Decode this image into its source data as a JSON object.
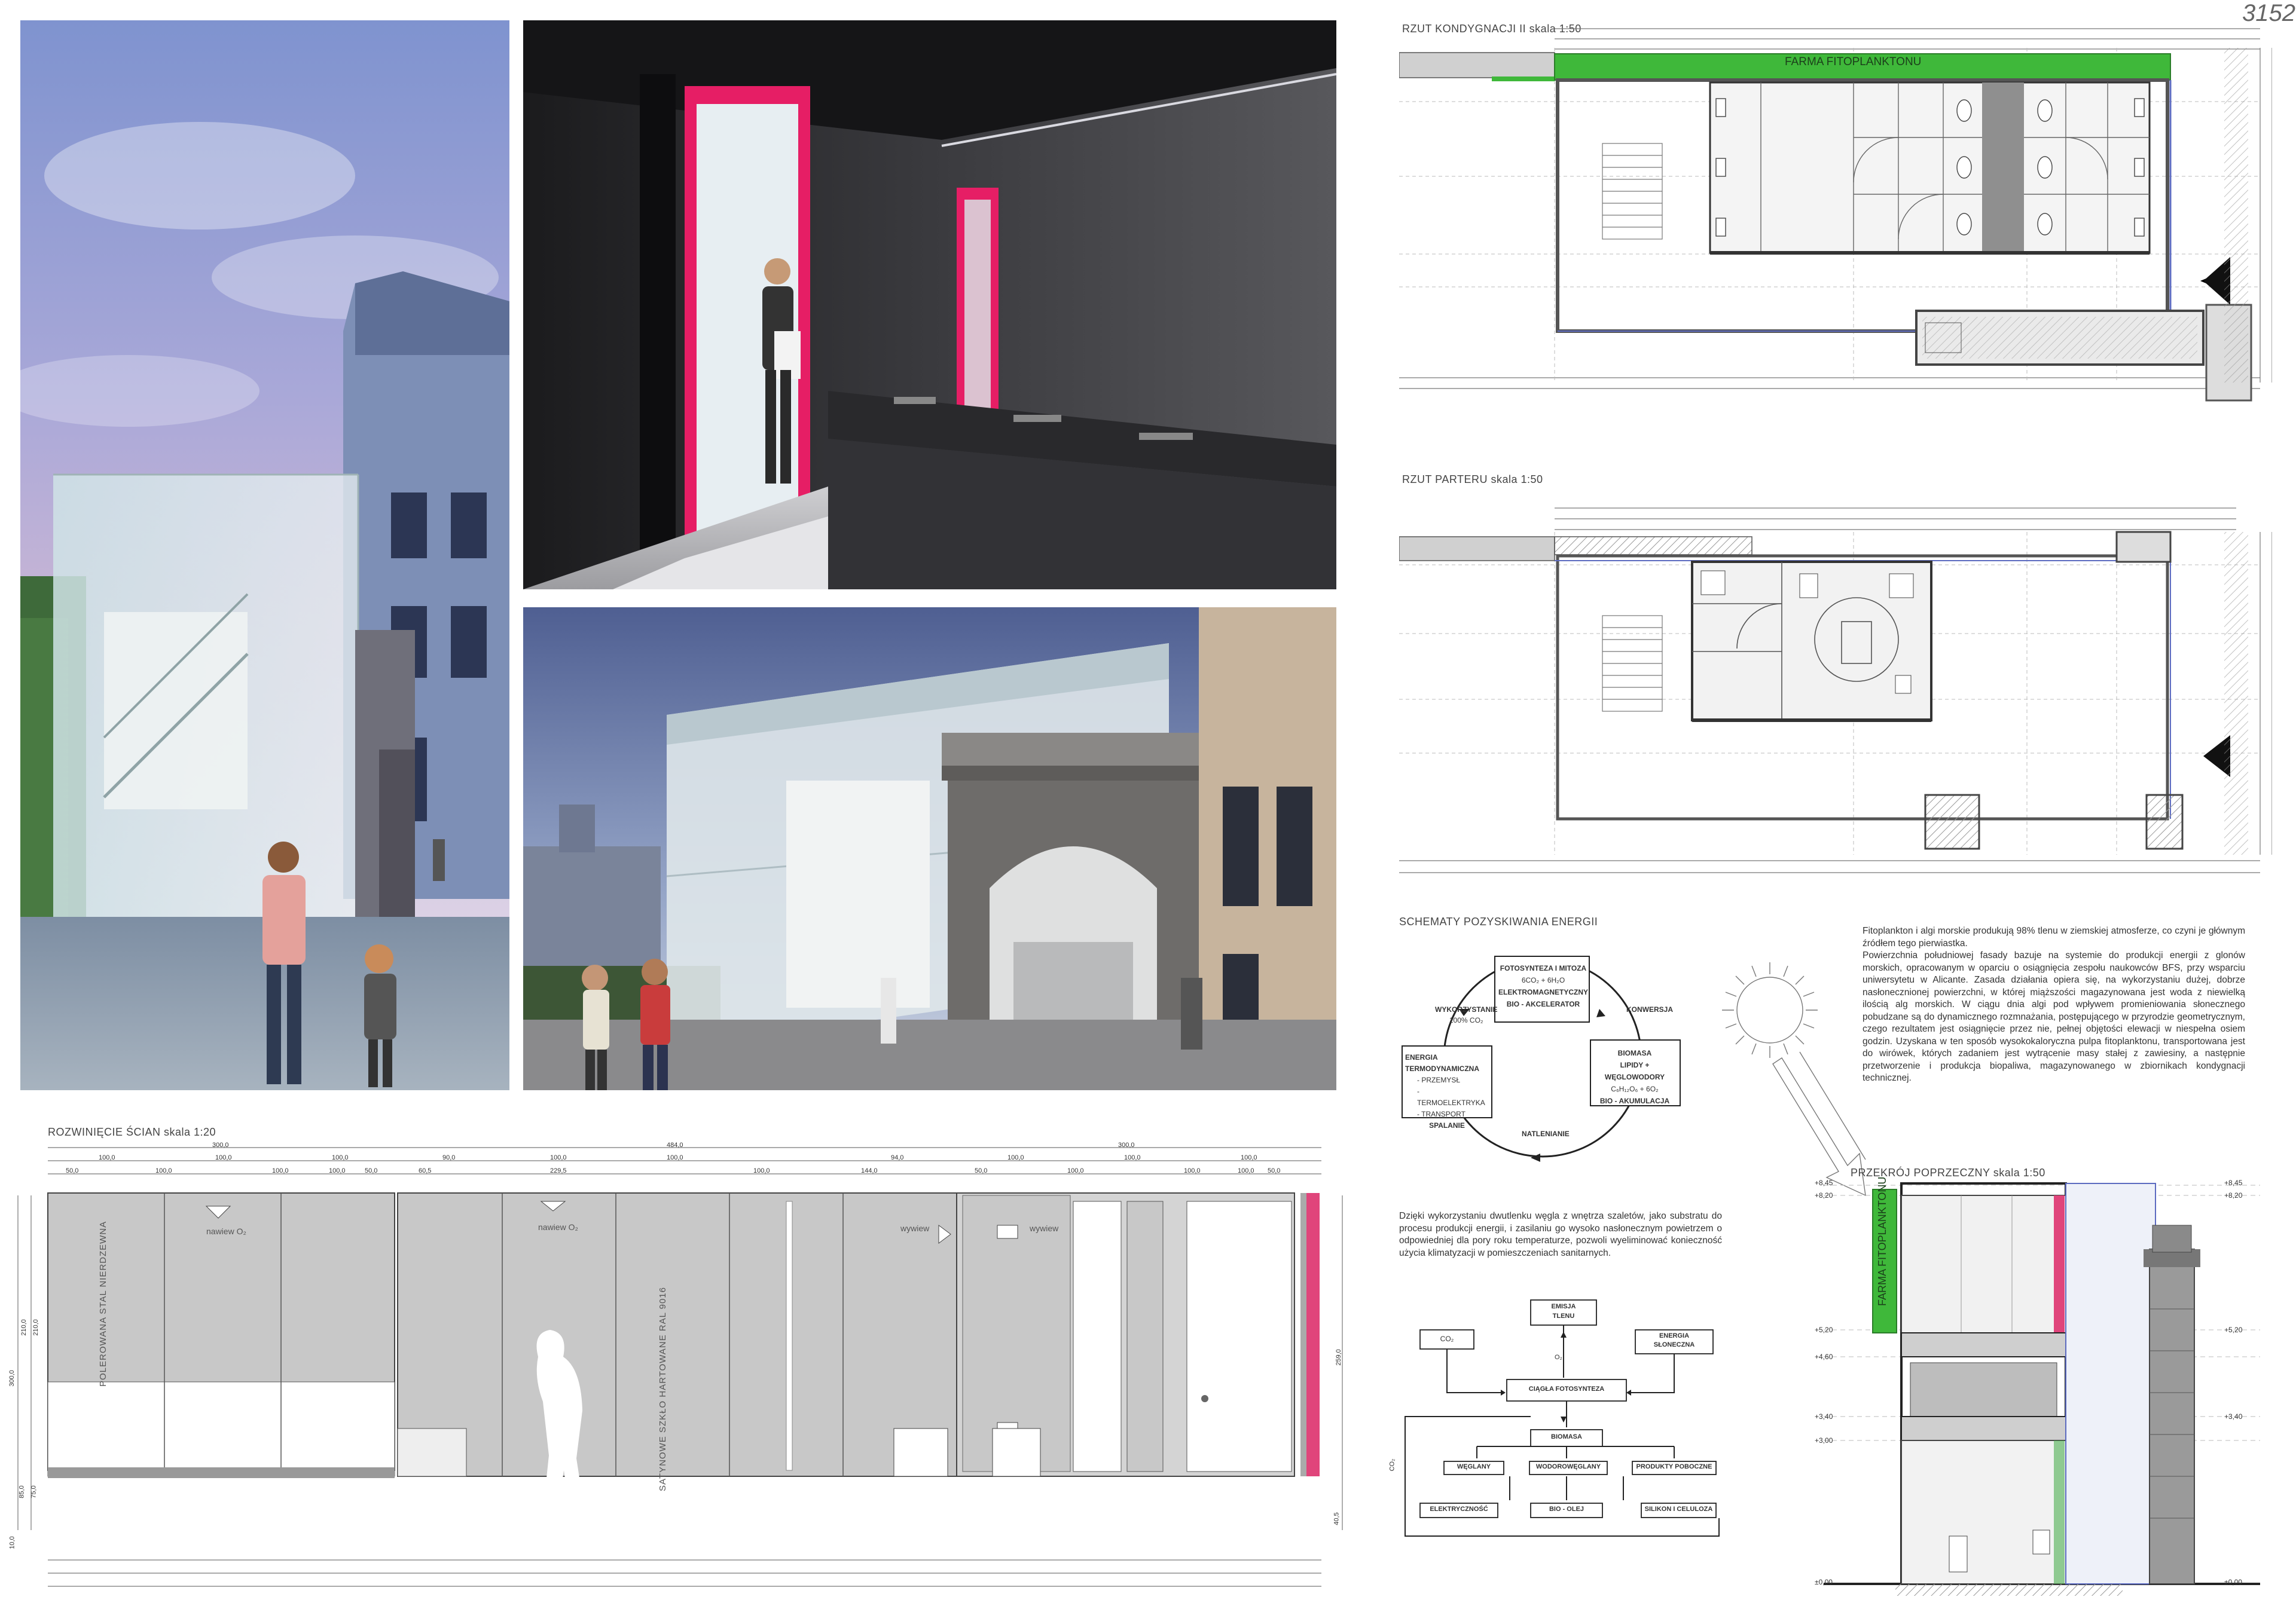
{
  "board_id": "3152",
  "titles": {
    "upper_plan": "RZUT KONDYGNACJI II skala 1:50",
    "ground_plan": "RZUT PARTERU skala 1:50",
    "wall_development": "ROZWINIĘCIE ŚCIAN skala 1:20",
    "energy_schemes": "SCHEMATY POZYSKIWANIA ENERGII",
    "cross_section": "PRZEKRÓJ POPRZECZNY skala 1:50"
  },
  "plan_labels": {
    "phyto_farm": "FARMA FITOPLANKTONU"
  },
  "description": {
    "p1": "Fitoplankton i algi morskie produkują 98% tlenu w ziemskiej atmosferze, co czyni je głównym źródłem tego pierwiastka.",
    "p2": "Powierzchnia południowej fasady bazuje na systemie do produkcji energii z glonów morskich, opracowanym w oparciu o osiągnięcia zespołu naukowców BFS, przy wsparciu uniwersytetu w Alicante. Zasada działania opiera się, na wykorzystaniu dużej, dobrze nasłonecznionej powierzchni, w której miąższości magazynowana jest woda z niewielką ilością alg morskich. W ciągu dnia algi pod wpływem promieniowania słonecznego pobudzane są do dynamicznego rozmnażania, postępującego w przyrodzie geometrycznym, czego rezultatem jest osiągnięcie przez nie, pełnej objętości elewacji w niespełna osiem godzin. Uzyskana w ten sposób wysokokaloryczna pulpa fitoplanktonu, transportowana jest do wirówek, których zadaniem jest wytrącenie masy stałej z zawiesiny, a następnie przetworzenie i produkcja biopaliwa, magazynowanego w zbiornikach kondygnacji technicznej.",
    "p3": "Dzięki wykorzystaniu dwutlenku węgla z wnętrza szaletów, jako substratu do procesu produkcji energii, i zasilaniu go wysoko nasłonecznym powietrzem o odpowiedniej dla pory roku temperaturze, pozwoli wyeliminować konieczność użycia klimatyzacji w pomieszczeniach sanitarnych."
  },
  "cycle_diagram": {
    "top_box": [
      "FOTOSYNTEZA I MITOZA",
      "6CO₂ + 6H₂O",
      "ELEKTROMAGNETYCZNY",
      "BIO - AKCELERATOR"
    ],
    "right_box": [
      "BIOMASA",
      "LIPIDY + WĘGLOWODORY",
      "C₆H₁₂O₆ + 6O₂",
      "BIO - AKUMULACJA"
    ],
    "left_box": [
      "ENERGIA TERMODYNAMICZNA",
      "- PRZEMYSŁ",
      "- TERMOELEKTRYKA",
      "- TRANSPORT",
      "SPALANIE"
    ],
    "label_left_top": [
      "WYKORZYSTANIE",
      "100% CO₂"
    ],
    "label_right_top": "KONWERSJA",
    "label_bottom": "NATLENIANIE"
  },
  "flow_diagram": {
    "emisja": [
      "EMISJA",
      "TLENU"
    ],
    "co2": "CO₂",
    "energia": [
      "ENERGIA",
      "SŁONECZNA"
    ],
    "fotosynteza": "CIĄGŁA FOTOSYNTEZA",
    "biomasa": "BIOMASA",
    "weglany": "WĘGLANY",
    "wodorowglany": "WODOROWĘGLANY",
    "produkty": "PRODUKTY POBOCZNE",
    "elektrycznosc": "ELEKTRYCZNOŚĆ",
    "bio_olej": "BIO - OLEJ",
    "silikon": "SILIKON I CELULOZA",
    "o2": "O₂",
    "co2_side": "CO₂"
  },
  "wall_labels": {
    "steel": "POLEROWANA STAL NIERDZEWNA",
    "glass": "SATYNOWE SZKŁO HARTOWANE    RAL 9016",
    "intake1": "nawiew O₂",
    "intake2": "nawiew O₂",
    "exhaust1": "wywiew",
    "exhaust2": "wywiew"
  },
  "wall_dims_top": {
    "row1": [
      "300,0",
      "484,0",
      "300,0"
    ],
    "row2": [
      "100,0",
      "100,0",
      "100,0",
      "90,0",
      "100,0",
      "100,0",
      "94,0",
      "100,0",
      "100,0",
      "100,0"
    ],
    "row3": [
      "50,0",
      "100,0",
      "100,0",
      "100,0",
      "50,0",
      "60,5",
      "229,5",
      "100,0",
      "144,0",
      "50,0",
      "100,0",
      "100,0",
      "100,0",
      "50,0"
    ]
  },
  "wall_dims_side": [
    "300,0",
    "210,0",
    "210,0",
    "85,0",
    "75,0",
    "10,0"
  ],
  "wall_dims_right": [
    "259,0",
    "40,5"
  ],
  "section_levels_left": [
    "+8,45",
    "+8,20",
    "+5,20",
    "+4,60",
    "+3,40",
    "+3,00",
    "±0,00"
  ],
  "section_levels_right": [
    "+8,45",
    "+8,20",
    "+5,20",
    "+3,40",
    "±0,00"
  ],
  "colors": {
    "accent_magenta": "#e0457b",
    "phyto_green": "#3fb83a",
    "glass_blue": "#5c6bc0"
  }
}
